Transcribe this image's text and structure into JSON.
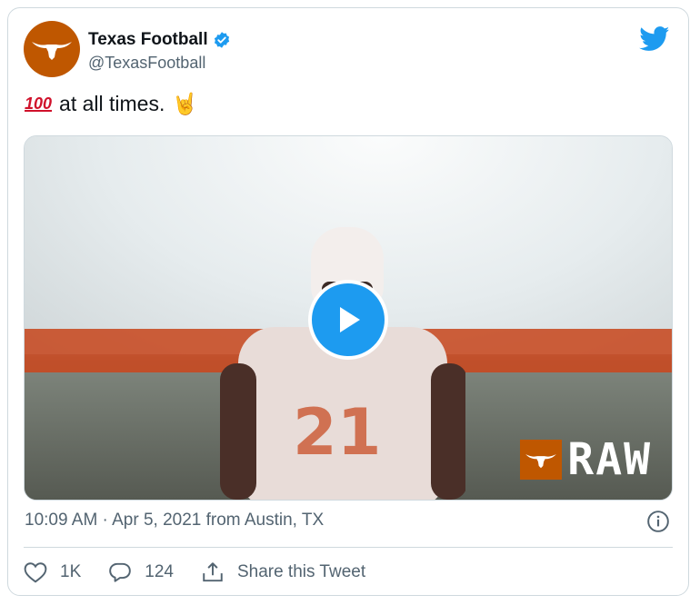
{
  "author": {
    "name": "Texas Football",
    "handle": "@TexasFootball",
    "verified": true,
    "avatar_color": "#bf5700"
  },
  "tweet": {
    "emoji_lead": "100-emoji",
    "text": "at all times.",
    "emoji_trail": "🤘"
  },
  "media": {
    "type": "video",
    "overlay_brand": "RAW",
    "jersey_number": "21"
  },
  "meta": {
    "timestamp": "10:09 AM · Apr 5, 2021 from Austin, TX"
  },
  "actions": {
    "likes": "1K",
    "replies": "124",
    "share_label": "Share this Tweet"
  },
  "colors": {
    "accent": "#1d9bf0",
    "brand": "#bf5700",
    "muted": "#536471"
  }
}
